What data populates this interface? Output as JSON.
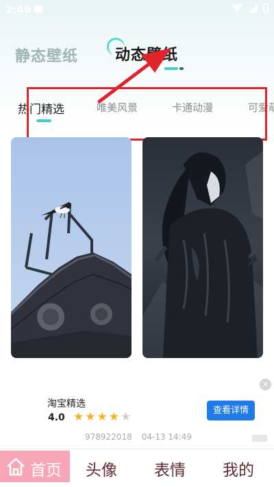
{
  "status_bar": {
    "time": "2:49"
  },
  "mode_tabs": {
    "static_label": "静态壁纸",
    "live_label": "动态壁纸",
    "active": "live"
  },
  "categories": [
    "热门精选",
    "唯美风景",
    "卡通动漫",
    "可爱萌"
  ],
  "active_category": "热门精选",
  "cards": [
    {
      "subject": "bird on roof ridge",
      "icon": "bird-rooftop-image"
    },
    {
      "subject": "anime warrior",
      "icon": "anime-character-image"
    }
  ],
  "ad": {
    "title": "淘宝精选",
    "rating": "4.0",
    "stars_filled": 4,
    "stars_total": 5,
    "button_label": "查看详情",
    "id": "978922018",
    "time": "04-13 14:49",
    "close_icon": "close-icon"
  },
  "bottom_nav": {
    "home": "首页",
    "avatar": "头像",
    "emoji": "表情",
    "mine": "我的"
  },
  "colors": {
    "accent": "#44ccc6",
    "home_tab_bg": "#f7a6b7",
    "nav_text": "#5e2a33",
    "annotation_red": "#e0242c",
    "ad_button": "#1e7be8"
  }
}
